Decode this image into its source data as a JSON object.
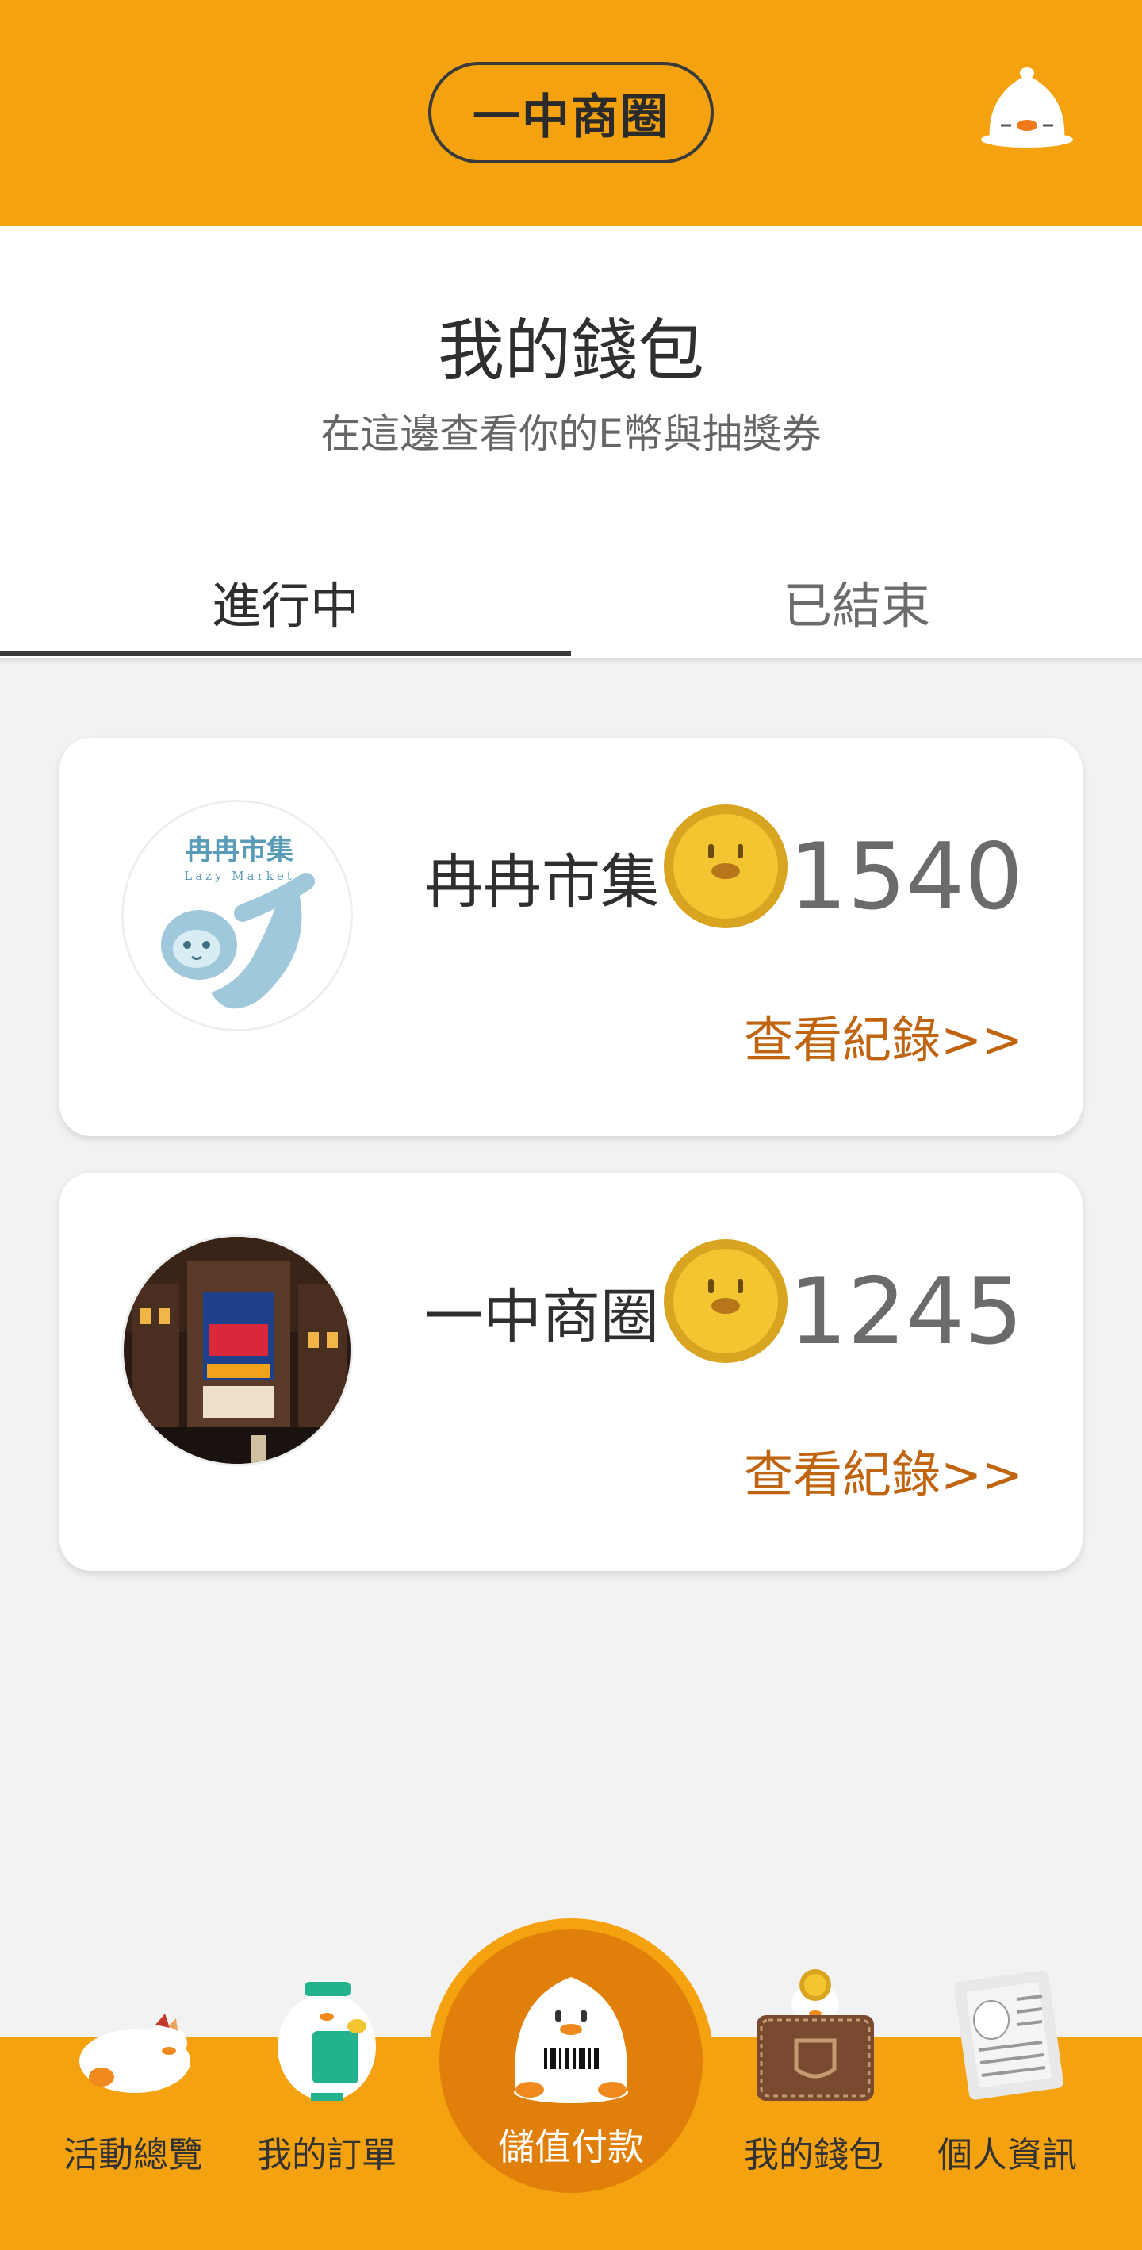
{
  "header": {
    "area_name": "一中商圈",
    "bell_icon": "duck-bell-icon"
  },
  "page": {
    "title": "我的錢包",
    "subtitle": "在這邊查看你的E幣與抽獎券"
  },
  "tabs": [
    {
      "label": "進行中",
      "active": true
    },
    {
      "label": "已結束",
      "active": false
    }
  ],
  "wallets": [
    {
      "store_name": "冉冉市集",
      "logo_text_cn": "冉冉市集",
      "logo_text_en": "Lazy Market",
      "balance": "1540",
      "view_records_label": "查看紀錄>>"
    },
    {
      "store_name": "一中商圈",
      "logo_text_cn": "",
      "balance": "1245",
      "view_records_label": "查看紀錄>>"
    }
  ],
  "nav": {
    "items": [
      {
        "label": "活動總覽",
        "icon": "lying-duck-icon"
      },
      {
        "label": "我的訂單",
        "icon": "duck-clipboard-icon"
      },
      {
        "label": "儲值付款",
        "icon": "duck-barcode-icon"
      },
      {
        "label": "我的錢包",
        "icon": "wallet-icon"
      },
      {
        "label": "個人資訊",
        "icon": "newspaper-icon"
      }
    ]
  },
  "colors": {
    "brand_orange": "#f4a20f",
    "center_orange": "#e07f0a",
    "link_orange": "#c06410",
    "coin_gold": "#f2c531"
  }
}
